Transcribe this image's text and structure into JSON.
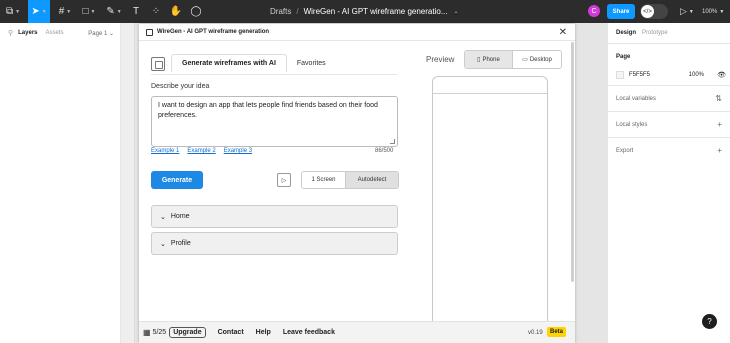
{
  "toolbar": {
    "breadcrumb": "Drafts",
    "separator": "/",
    "file_name": "WireGen - AI GPT wireframe generatio...",
    "avatar_initial": "C",
    "share_label": "Share",
    "zoom_label": "100%"
  },
  "left_panel": {
    "layers_tab": "Layers",
    "assets_tab": "Assets",
    "page_selector": "Page 1"
  },
  "plugin": {
    "title": "WireGen - AI GPT wireframe generation",
    "tabs": [
      "Generate wireframes with AI",
      "Favorites"
    ],
    "describe_label": "Describe your idea",
    "prompt_value": "I want to design an app that lets people find friends based on their food preferences.",
    "examples": [
      "Example 1",
      "Example 2",
      "Example 3"
    ],
    "char_count": "86/500",
    "generate_label": "Generate",
    "screen_options": [
      "1 Screen",
      "Autodetect"
    ],
    "accordions": [
      "Home",
      "Profile"
    ],
    "preview_label": "Preview",
    "device_options": [
      "Phone",
      "Desktop"
    ],
    "footer": {
      "credits": "5/25",
      "upgrade": "Upgrade",
      "links": [
        "Contact",
        "Help",
        "Leave feedback"
      ],
      "version": "v0.19",
      "badge": "Beta"
    }
  },
  "right_panel": {
    "design_tab": "Design",
    "prototype_tab": "Prototype",
    "page_title": "Page",
    "page_color": "F5F5F5",
    "page_opacity": "100%",
    "local_variables": "Local variables",
    "local_styles": "Local styles",
    "export": "Export"
  },
  "help_label": "?",
  "colors": {
    "accent": "#0d99ff",
    "generate": "#1e88e5",
    "beta": "#ffd400",
    "avatar": "#d23ad8"
  }
}
